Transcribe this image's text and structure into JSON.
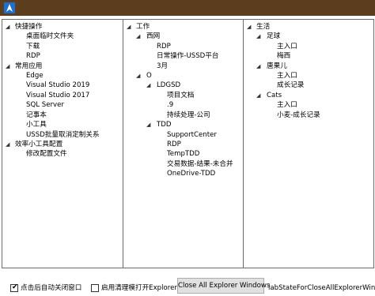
{
  "window": {
    "icon": "arrow-app-icon",
    "title_bar_color": "#5c3d1e"
  },
  "panels": {
    "p1": {
      "groups": [
        {
          "label": "快捷操作",
          "items": [
            "桌面临时文件夹",
            "下载",
            "RDP"
          ]
        },
        {
          "label": "常用应用",
          "items": [
            "Edge",
            "Visual Studio 2019",
            "Visual Studio 2017",
            "SQL Server",
            "记事本",
            "小工具",
            "USSD批量取消定制关系"
          ]
        },
        {
          "label": "效率小工具配置",
          "items": [
            "修改配置文件"
          ]
        }
      ]
    },
    "p2": {
      "root": "工作",
      "xiwang": {
        "label": "西网",
        "items": [
          "RDP",
          "日常操作-USSD平台",
          "3月"
        ]
      },
      "o": {
        "label": "O",
        "ldgsd": {
          "label": "LDGSD",
          "items": [
            "项目文档",
            ".9",
            "持续处理-公司"
          ]
        },
        "tdd": {
          "label": "TDD",
          "items": [
            "SupportCenter",
            "RDP",
            "TempTDD",
            "交易数据-结果-未合并",
            "OneDrive-TDD"
          ]
        }
      }
    },
    "p3": {
      "root": "生活",
      "groups": [
        {
          "label": "足球",
          "items": [
            "主入口",
            "梅西"
          ]
        },
        {
          "label": "唐果儿",
          "items": [
            "主入口",
            "成长记录"
          ]
        },
        {
          "label": "Cats",
          "items": [
            "主入口",
            "小麦-成长记录"
          ]
        }
      ]
    }
  },
  "footer": {
    "auto_close_label": "点击后自动关闭窗口",
    "auto_close_checked": true,
    "clean_open_label": "启用清理模打开Explorer",
    "clean_open_checked": false,
    "close_all_button": "Close All Explorer Windows",
    "status_label": "labStateForCloseAllExplorerWindow"
  }
}
